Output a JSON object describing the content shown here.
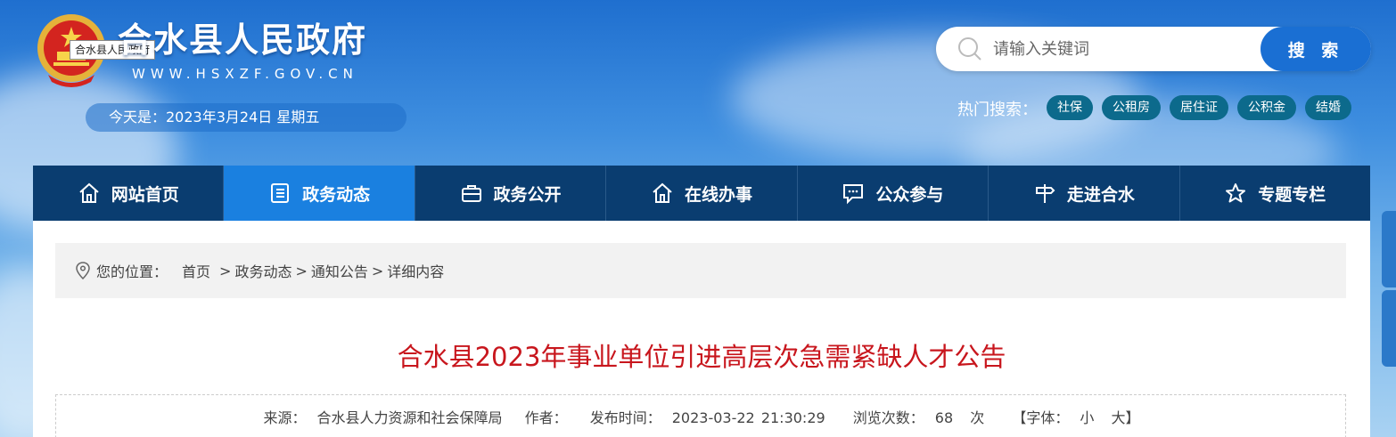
{
  "header": {
    "site_title": "合水县人民政府",
    "site_url": "WWW.HSXZF.GOV.CN",
    "emblem_tooltip": "合水县人民政府",
    "date_text": "今天是：2023年3月24日 星期五"
  },
  "search": {
    "placeholder": "请输入关键词",
    "button_label": "搜 索",
    "hot_label": "热门搜索：",
    "hot_tags": [
      "社保",
      "公租房",
      "居住证",
      "公积金",
      "结婚"
    ]
  },
  "nav": {
    "items": [
      {
        "label": "网站首页",
        "icon": "home-icon"
      },
      {
        "label": "政务动态",
        "icon": "document-list-icon"
      },
      {
        "label": "政务公开",
        "icon": "briefcase-icon"
      },
      {
        "label": "在线办事",
        "icon": "home-outline-icon"
      },
      {
        "label": "公众参与",
        "icon": "chat-icon"
      },
      {
        "label": "走进合水",
        "icon": "signpost-icon"
      },
      {
        "label": "专题专栏",
        "icon": "star-icon"
      }
    ],
    "active_index": 1
  },
  "breadcrumb": {
    "prefix": "您的位置：",
    "items": [
      "首页",
      "政务动态",
      "通知公告",
      "详细内容"
    ]
  },
  "article": {
    "title": "合水县2023年事业单位引进高层次急需紧缺人才公告",
    "meta": {
      "source_label": "来源：",
      "source": "合水县人力资源和社会保障局",
      "author_label": "作者：",
      "publish_label": "发布时间：",
      "publish_time": "2023-03-22 21:30:29",
      "views_label": "浏览次数：",
      "views": "68",
      "views_unit": "次",
      "font_label": "【字体：",
      "font_small": "小",
      "font_large": "大】"
    }
  },
  "colors": {
    "nav_bg": "#0a3d70",
    "nav_active": "#1a80e0",
    "title_red": "#c8161d",
    "search_button": "#1a6fd3",
    "hot_tag_bg": "#0c6a8c"
  }
}
